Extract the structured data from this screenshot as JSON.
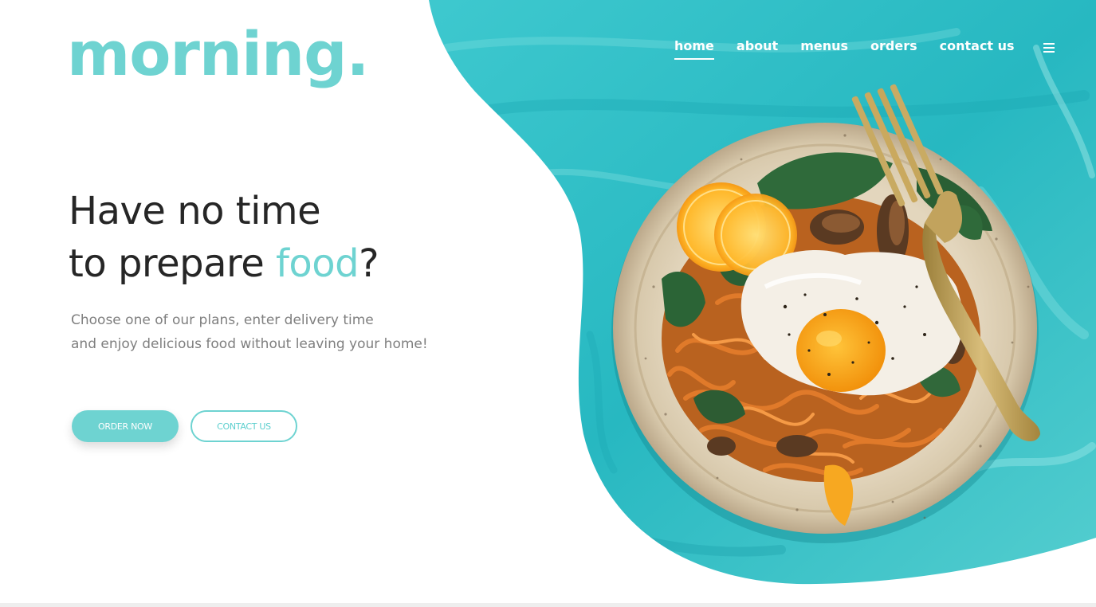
{
  "brand": {
    "logo": "morning.",
    "accent_color": "#6ed3d1"
  },
  "nav": {
    "items": [
      {
        "label": "home",
        "active": true
      },
      {
        "label": "about"
      },
      {
        "label": "menus"
      },
      {
        "label": "orders"
      },
      {
        "label": "contact us"
      }
    ],
    "menu_icon": "hamburger-menu-icon"
  },
  "hero": {
    "headline_line1": "Have no time",
    "headline_line2_pre": "to prepare ",
    "headline_line2_accent": "food",
    "headline_line2_post": "?",
    "subtext_line1": "Choose one of our plans, enter delivery time",
    "subtext_line2": "and enjoy delicious food without leaving your home!",
    "image": "plate-with-fried-egg-noodles-greens-and-fork"
  },
  "buttons": {
    "order_now": "ORDER NOW",
    "contact_us": "CONTACT US"
  }
}
